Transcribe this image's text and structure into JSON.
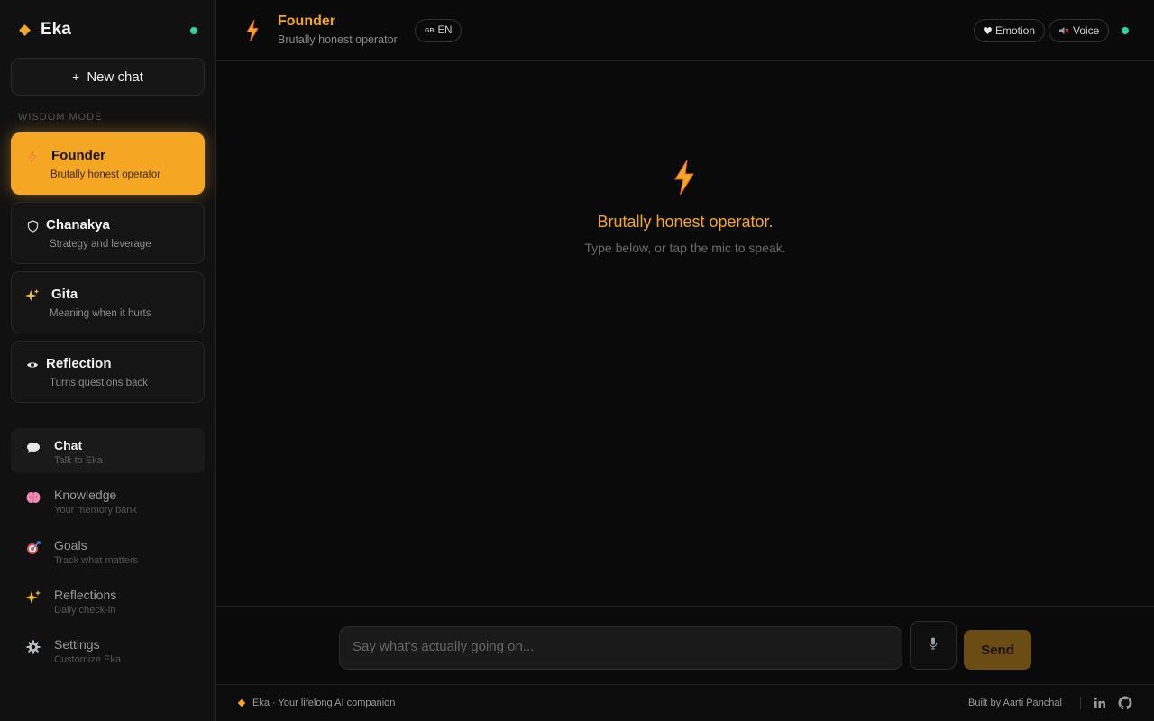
{
  "app": {
    "name": "Eka"
  },
  "sidebar": {
    "new_chat_label": "New chat",
    "section_label": "WISDOM MODE",
    "modes": [
      {
        "title": "Founder",
        "subtitle": "Brutally honest operator",
        "icon": "lightning-icon",
        "active": true
      },
      {
        "title": "Chanakya",
        "subtitle": "Strategy and leverage",
        "icon": "shield-icon"
      },
      {
        "title": "Gita",
        "subtitle": "Meaning when it hurts",
        "icon": "sparkles-icon"
      },
      {
        "title": "Reflection",
        "subtitle": "Turns questions back",
        "icon": "eye-icon"
      }
    ],
    "nav": [
      {
        "title": "Chat",
        "subtitle": "Talk to Eka",
        "icon": "speech-bubble-icon",
        "active": true
      },
      {
        "title": "Knowledge",
        "subtitle": "Your memory bank",
        "icon": "brain-icon"
      },
      {
        "title": "Goals",
        "subtitle": "Track what matters",
        "icon": "target-icon"
      },
      {
        "title": "Reflections",
        "subtitle": "Daily check-in",
        "icon": "sparkles-icon"
      },
      {
        "title": "Settings",
        "subtitle": "Customize Eka",
        "icon": "gear-icon"
      }
    ]
  },
  "header": {
    "title": "Founder",
    "subtitle": "Brutally honest operator",
    "language_flag": "GB",
    "language": "EN",
    "emotion_label": "Emotion",
    "voice_label": "Voice"
  },
  "main": {
    "hero_title": "Brutally honest operator.",
    "hero_subtitle": "Type below, or tap the mic to speak."
  },
  "composer": {
    "placeholder": "Say what's actually going on...",
    "send_label": "Send"
  },
  "footer": {
    "tagline": "Eka · Your lifelong AI companion",
    "credit": "Built by Aarti Panchal"
  },
  "colors": {
    "accent": "#f5a623",
    "status": "#34d399",
    "background": "#0a0a0a",
    "sidebar": "#111111"
  }
}
